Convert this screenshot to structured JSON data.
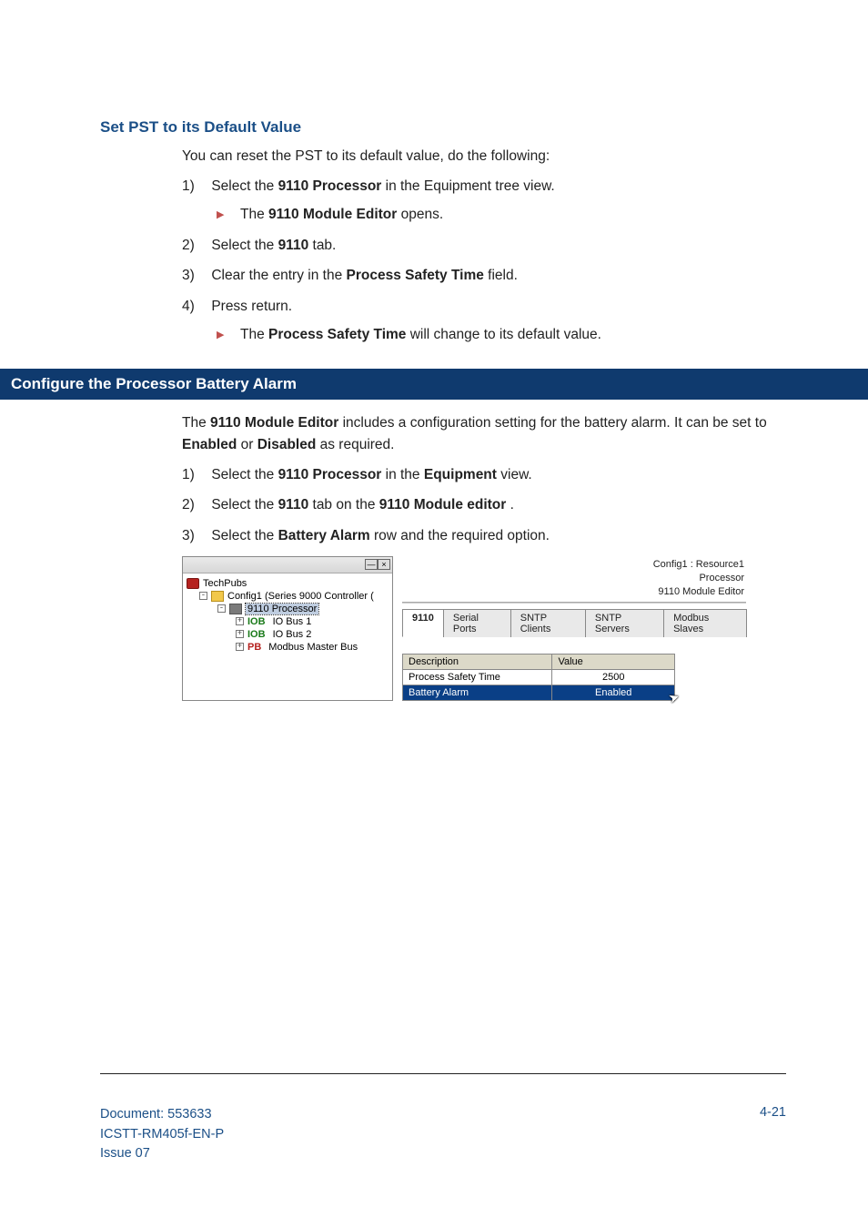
{
  "section1": {
    "heading": "Set PST to its Default Value",
    "intro": "You can reset the PST to its default value, do the following:",
    "items": [
      {
        "num": "1)",
        "pre": "Select the ",
        "bold": "9110 Processor",
        "post": " in the Equipment tree view."
      },
      {
        "num": "2)",
        "pre": "Select the ",
        "bold": "9110",
        "post": " tab."
      },
      {
        "num": "3)",
        "pre": "Clear the entry in the ",
        "bold": "Process Safety Time",
        "post": " field."
      },
      {
        "num": "4)",
        "pre": "Press return.",
        "bold": "",
        "post": ""
      }
    ],
    "sub1": {
      "pre": "The ",
      "bold": "9110 Module Editor",
      "post": " opens."
    },
    "sub4": {
      "pre": "The ",
      "bold": "Process Safety Time",
      "post": " will change to its default value."
    }
  },
  "section2": {
    "bar": "Configure the Processor Battery Alarm",
    "intro_parts": {
      "p1": "The ",
      "b1": "9110 Module Editor",
      "p2": " includes a configuration setting for the battery alarm. It can be set to ",
      "b2": "Enabled",
      "p3": " or ",
      "b3": "Disabled",
      "p4": " as required."
    },
    "items": [
      {
        "num": "1)",
        "pre": "Select the ",
        "b1": "9110 Processor",
        "mid": " in the ",
        "b2": "Equipment",
        "post": " view."
      },
      {
        "num": "2)",
        "pre": "Select the ",
        "b1": "9110",
        "mid": " tab on the ",
        "b2": "9110 Module editor",
        "post": " ."
      },
      {
        "num": "3)",
        "pre": "Select the ",
        "b1": "Battery Alarm",
        "mid": " row and the required option.",
        "b2": "",
        "post": ""
      }
    ]
  },
  "figure": {
    "tree": {
      "root": "TechPubs",
      "config": "Config1 (Series 9000 Controller (",
      "processor": "9110 Processor",
      "iob1": {
        "tag": "IOB",
        "label": "IO Bus 1"
      },
      "iob2": {
        "tag": "IOB",
        "label": "IO Bus 2"
      },
      "pb": {
        "tag": "PB",
        "label": "Modbus Master Bus"
      },
      "win_min": "—",
      "win_close": "×"
    },
    "right": {
      "breadcrumb": "Config1 : Resource1",
      "title": "Processor",
      "subtitle": "9110 Module Editor",
      "tabs": [
        "9110",
        "Serial Ports",
        "SNTP Clients",
        "SNTP Servers",
        "Modbus Slaves"
      ],
      "cols": {
        "desc": "Description",
        "val": "Value"
      },
      "rows": [
        {
          "desc": "Process Safety Time",
          "val": "2500",
          "sel": false
        },
        {
          "desc": "Battery Alarm",
          "val": "Enabled",
          "sel": true
        }
      ]
    }
  },
  "footer": {
    "doc": "Document: 553633",
    "pn": "ICSTT-RM405f-EN-P",
    "issue": "Issue 07",
    "page": "4-21"
  }
}
